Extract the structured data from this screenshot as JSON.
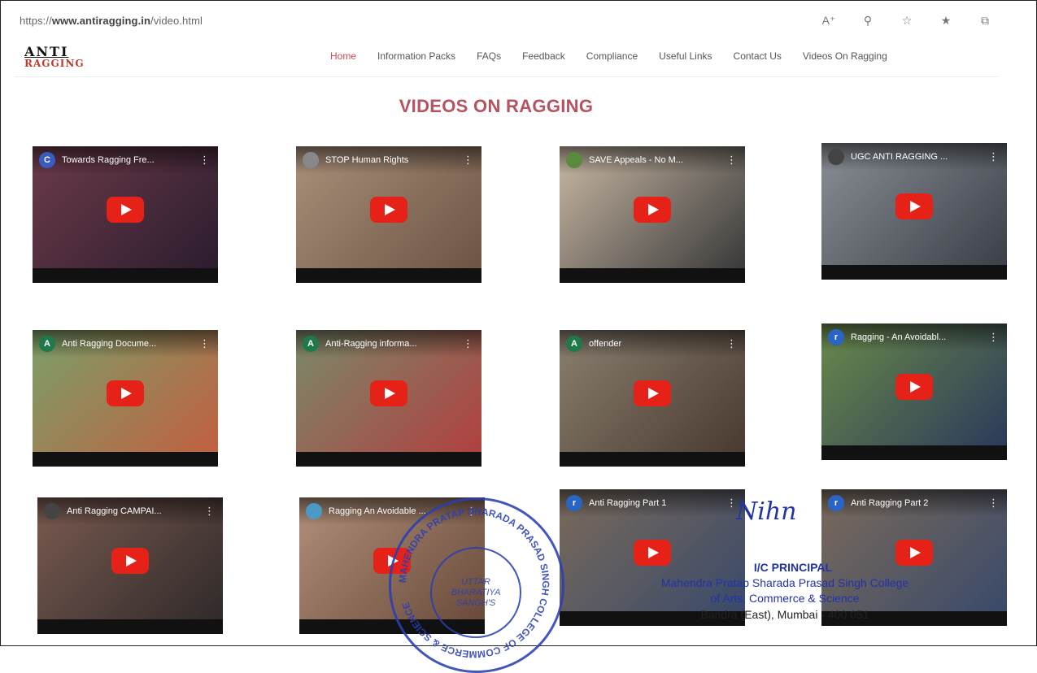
{
  "browser": {
    "url_prefix": "https://",
    "url_domain": "www.antiragging.in",
    "url_path": "/video.html",
    "tools": [
      "read-aloud-icon",
      "zoom-icon",
      "favorite-icon",
      "favorites-list-icon",
      "collections-icon"
    ]
  },
  "logo": {
    "line1": "ANTI",
    "line2": "RAGGING"
  },
  "nav": {
    "items": [
      "Home",
      "Information Packs",
      "FAQs",
      "Feedback",
      "Compliance",
      "Useful Links",
      "Contact Us",
      "Videos On Ragging"
    ],
    "active": "Home"
  },
  "page": {
    "heading": "VIDEOS ON RAGGING"
  },
  "videos": [
    {
      "title": "Towards Ragging Fre...",
      "avatar": "C",
      "avatar_color": "#3a5bbf",
      "thumb": [
        "#6b3a4a",
        "#2c1d2e"
      ]
    },
    {
      "title": "STOP Human Rights",
      "avatar": "",
      "avatar_color": "#888888",
      "thumb": [
        "#a9907a",
        "#6d5444"
      ]
    },
    {
      "title": "SAVE Appeals - No M...",
      "avatar": "",
      "avatar_color": "#5a8a3c",
      "thumb": [
        "#c9b8a4",
        "#3a3a3a"
      ]
    },
    {
      "title": "UGC ANTI RAGGING ...",
      "avatar": "",
      "avatar_color": "#444444",
      "thumb": [
        "#8a8f96",
        "#3b4048"
      ]
    },
    {
      "title": "Anti Ragging Docume...",
      "avatar": "A",
      "avatar_color": "#1f7a4a",
      "thumb": [
        "#7aa06a",
        "#c06040"
      ]
    },
    {
      "title": "Anti-Ragging informa...",
      "avatar": "A",
      "avatar_color": "#1f7a4a",
      "thumb": [
        "#7a8a6a",
        "#b04040"
      ]
    },
    {
      "title": "offender",
      "avatar": "A",
      "avatar_color": "#1f7a4a",
      "thumb": [
        "#8a8070",
        "#4a3a30"
      ]
    },
    {
      "title": "Ragging - An Avoidabl...",
      "avatar": "r",
      "avatar_color": "#2a64c4",
      "thumb": [
        "#6a8a4a",
        "#2c3a5a"
      ]
    },
    {
      "title": "Anti Ragging CAMPAI...",
      "avatar": "",
      "avatar_color": "#444444",
      "thumb": [
        "#7a5a50",
        "#302a2a"
      ]
    },
    {
      "title": "Ragging An Avoidable ...",
      "avatar": "",
      "avatar_color": "#4a9ac4",
      "thumb": [
        "#b0907a",
        "#6a4a3a"
      ]
    },
    {
      "title": "Anti Ragging Part 1",
      "avatar": "r",
      "avatar_color": "#2a64c4",
      "thumb": [
        "#7a6a5a",
        "#3a4a6a"
      ]
    },
    {
      "title": "Anti Ragging Part 2",
      "avatar": "r",
      "avatar_color": "#2a64c4",
      "thumb": [
        "#7a6a5a",
        "#3a4a6a"
      ]
    }
  ],
  "stamp": {
    "ring_text": "MAHENDRA PRATAP SHARADA PRASAD SINGH COLLEGE OF COMMERCE & SCIENCE",
    "center": [
      "UTTAR",
      "BHARATIYA",
      "SANGH'S"
    ]
  },
  "signature": {
    "scribble": "Nihn",
    "title": "I/C PRINCIPAL",
    "line1": "Mahendra Pratap Sharada Prasad Singh College",
    "line2": "of Arts, Commerce & Science",
    "line3": "Bandra (East), Mumbai - 400 051"
  },
  "colors": {
    "accent": "#b7525f",
    "youtube_red": "#e62117",
    "stamp_blue": "#2a3fb3"
  }
}
